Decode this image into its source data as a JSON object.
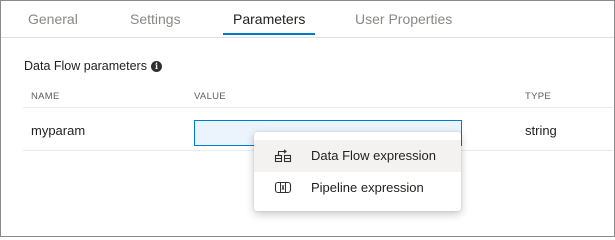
{
  "tabs": [
    {
      "label": "General"
    },
    {
      "label": "Settings"
    },
    {
      "label": "Parameters",
      "active": true
    },
    {
      "label": "User Properties"
    }
  ],
  "section": {
    "title": "Data Flow parameters",
    "info_icon": "info-icon"
  },
  "table": {
    "headers": {
      "name": "NAME",
      "value": "VALUE",
      "type": "TYPE"
    },
    "rows": [
      {
        "name": "myparam",
        "value": "",
        "type": "string"
      }
    ]
  },
  "menu": {
    "items": [
      {
        "label": "Data Flow expression",
        "icon": "data-flow-expression-icon"
      },
      {
        "label": "Pipeline expression",
        "icon": "pipeline-expression-icon"
      }
    ]
  },
  "colors": {
    "accent": "#0078d4",
    "input_bg": "#ebf3fc",
    "hover_bg": "#f3f2f1"
  }
}
